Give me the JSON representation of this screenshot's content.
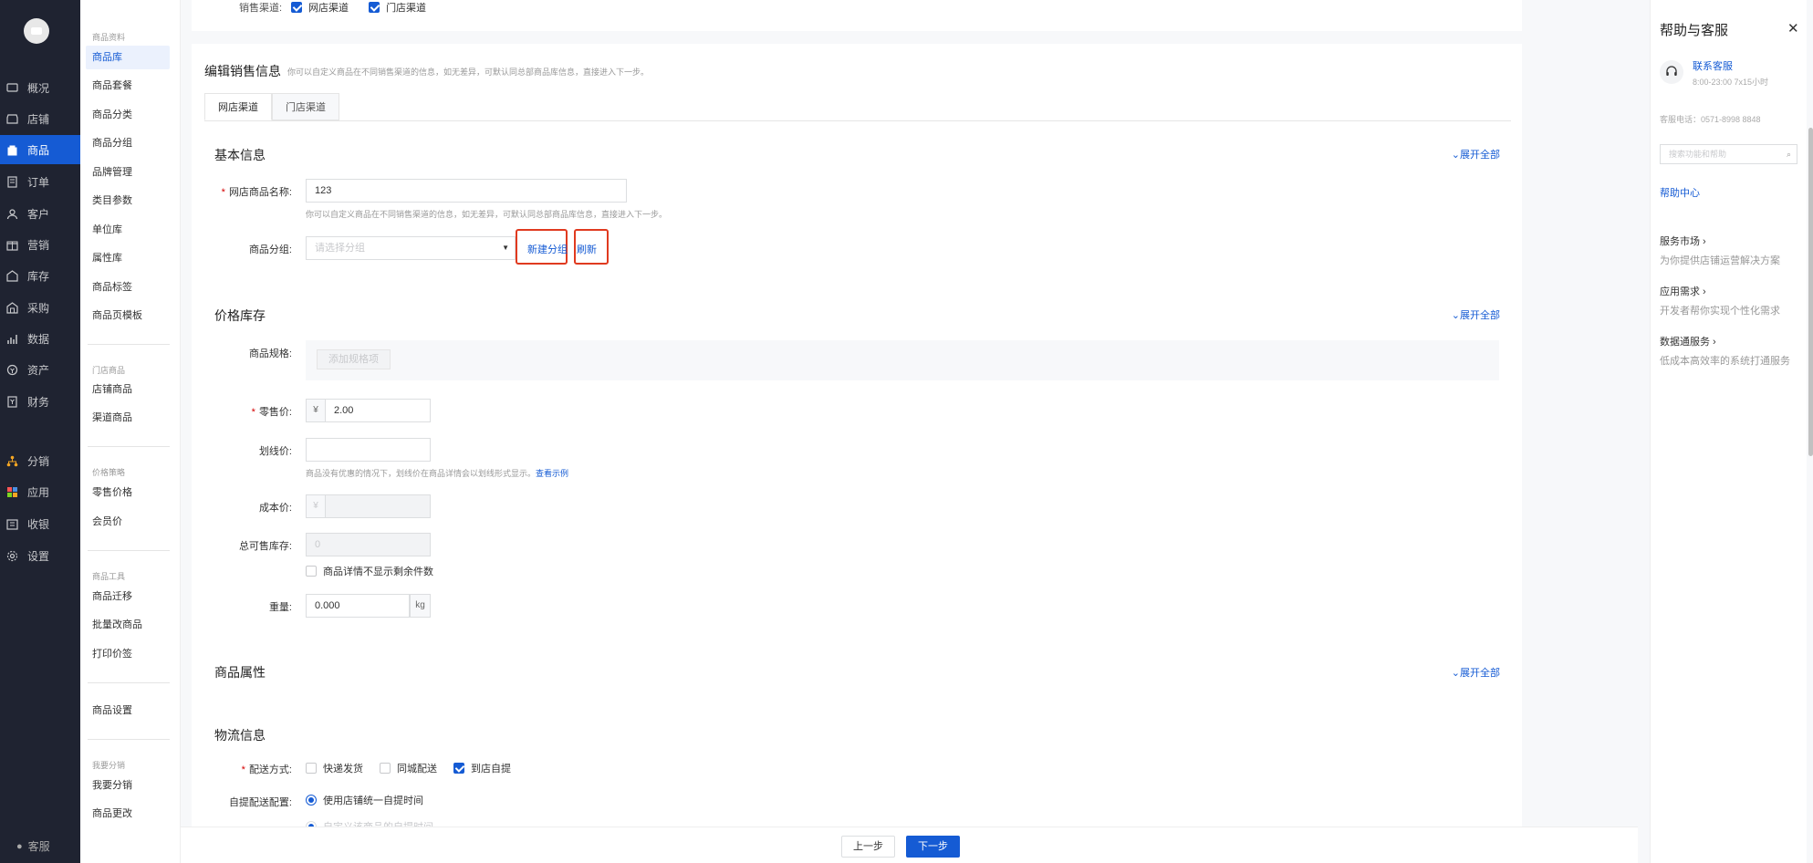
{
  "nav": {
    "items": [
      {
        "label": "概况",
        "icon": "overview-icon"
      },
      {
        "label": "店铺",
        "icon": "store-icon"
      },
      {
        "label": "商品",
        "icon": "goods-icon"
      },
      {
        "label": "订单",
        "icon": "order-icon"
      },
      {
        "label": "客户",
        "icon": "customer-icon"
      },
      {
        "label": "营销",
        "icon": "marketing-icon"
      },
      {
        "label": "库存",
        "icon": "inventory-icon"
      },
      {
        "label": "采购",
        "icon": "purchase-icon"
      },
      {
        "label": "数据",
        "icon": "data-icon"
      },
      {
        "label": "资产",
        "icon": "asset-icon"
      },
      {
        "label": "财务",
        "icon": "finance-icon"
      },
      {
        "label": "分销",
        "icon": "distribution-icon"
      },
      {
        "label": "应用",
        "icon": "apps-icon"
      },
      {
        "label": "收银",
        "icon": "cashier-icon"
      },
      {
        "label": "设置",
        "icon": "settings-icon"
      }
    ],
    "footer": "客服"
  },
  "subnav": {
    "groups": [
      {
        "title": "商品资料",
        "items": [
          "商品库",
          "商品套餐",
          "商品分类",
          "商品分组",
          "品牌管理",
          "类目参数",
          "单位库",
          "属性库",
          "商品标签",
          "商品页模板"
        ]
      },
      {
        "title": "门店商品",
        "items": [
          "店铺商品",
          "渠道商品"
        ]
      },
      {
        "title": "价格策略",
        "items": [
          "零售价格",
          "会员价"
        ]
      },
      {
        "title": "商品工具",
        "items": [
          "商品迁移",
          "批量改商品",
          "打印价签"
        ]
      },
      {
        "title": "",
        "items": [
          "商品设置"
        ]
      },
      {
        "title": "我要分销",
        "items": [
          "我要分销",
          "商品更改"
        ]
      }
    ]
  },
  "top": {
    "channel_label": "销售渠道:",
    "online": "网店渠道",
    "offline": "门店渠道"
  },
  "edit": {
    "title": "编辑销售信息",
    "desc": "你可以自定义商品在不同销售渠道的信息，如无差异，可默认同总部商品库信息，直接进入下一步。",
    "tabs": [
      "网店渠道",
      "门店渠道"
    ]
  },
  "basic": {
    "title": "基本信息",
    "expand": "展开全部",
    "name_label": "网店商品名称:",
    "name_value": "123",
    "name_hint": "你可以自定义商品在不同销售渠道的信息，如无差异，可默认同总部商品库信息，直接进入下一步。",
    "group_label": "商品分组:",
    "group_placeholder": "请选择分组",
    "new_group": "新建分组",
    "refresh": "刷新"
  },
  "price": {
    "title": "价格库存",
    "expand": "展开全部",
    "spec_label": "商品规格:",
    "spec_add": "添加规格项",
    "retail_label": "零售价:",
    "currency": "¥",
    "retail_value": "2.00",
    "strike_label": "划线价:",
    "strike_hint": "商品没有优惠的情况下，划线价在商品详情会以划线形式显示。",
    "strike_hint_link": "查看示例",
    "cost_label": "成本价:",
    "stock_label": "总可售库存:",
    "stock_value": "0",
    "hide_stock": "商品详情不显示剩余件数",
    "weight_label": "重量:",
    "weight_value": "0.000",
    "weight_unit": "kg"
  },
  "attr": {
    "title": "商品属性",
    "expand": "展开全部"
  },
  "logistics": {
    "title": "物流信息",
    "delivery_label": "配送方式:",
    "express": "快递发货",
    "city": "同城配送",
    "pickup": "到店自提",
    "pickup_cfg_label": "自提配送配置:",
    "pickup_cfg_option": "使用店铺统一自提时间",
    "pickup_cfg_option2": "自定义该商品的自提时间"
  },
  "footer": {
    "prev": "上一步",
    "next": "下一步"
  },
  "help": {
    "title": "帮助与客服",
    "close": "✕",
    "kf_name": "联系客服",
    "kf_time": "8:00-23:00  7x15小时",
    "phone": "客服电话：0571-8998 8848",
    "search_placeholder": "搜索功能和帮助",
    "help_center": "帮助中心",
    "services": [
      {
        "title": "服务市场 ›",
        "desc": "为你提供店铺运营解决方案"
      },
      {
        "title": "应用需求 ›",
        "desc": "开发者帮你实现个性化需求"
      },
      {
        "title": "数据通服务 ›",
        "desc": "低成本高效率的系统打通服务"
      }
    ]
  },
  "colors": {
    "nav_bg": "#1f2331",
    "accent": "#155bd4",
    "highlight_box": "#e03a1f"
  }
}
